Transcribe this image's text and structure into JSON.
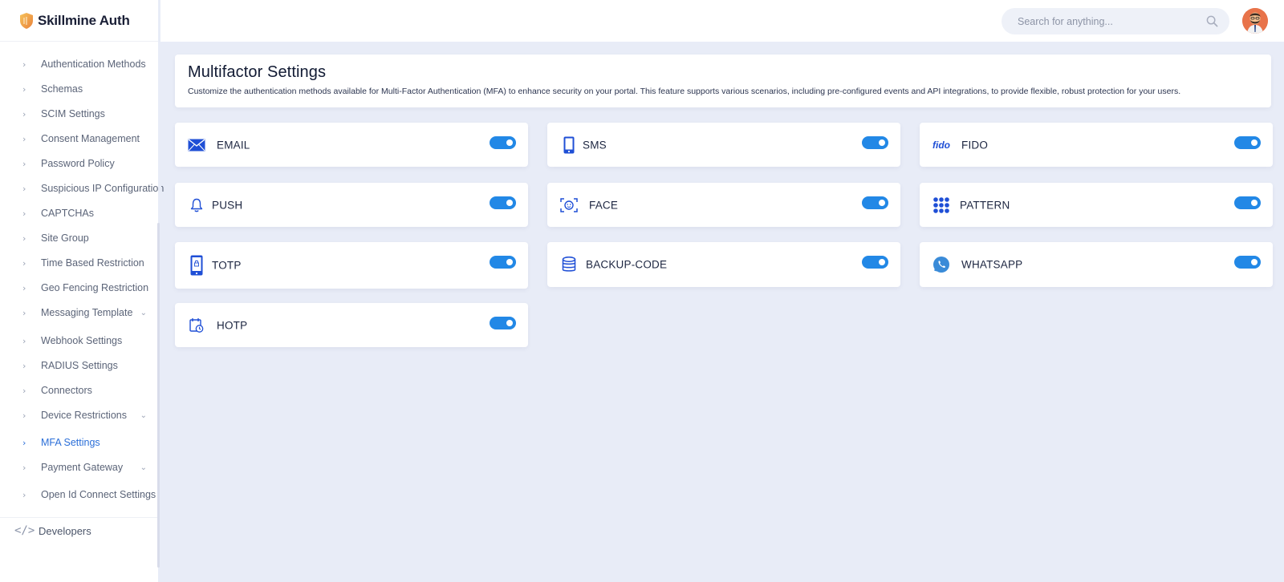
{
  "brand": {
    "name": "Skillmine Auth"
  },
  "header": {
    "search_placeholder": "Search for anything..."
  },
  "sidebar": {
    "items": [
      {
        "label": "Authentication Methods",
        "has_caret": false
      },
      {
        "label": "Schemas",
        "has_caret": false
      },
      {
        "label": "SCIM Settings",
        "has_caret": false
      },
      {
        "label": "Consent Management",
        "has_caret": false
      },
      {
        "label": "Password Policy",
        "has_caret": false
      },
      {
        "label": "Suspicious IP Configuration",
        "has_caret": false
      },
      {
        "label": "CAPTCHAs",
        "has_caret": false
      },
      {
        "label": "Site Group",
        "has_caret": false
      },
      {
        "label": "Time Based Restriction",
        "has_caret": false
      },
      {
        "label": "Geo Fencing Restriction",
        "has_caret": false
      },
      {
        "label": "Messaging Template",
        "has_caret": true
      },
      {
        "label": "Webhook Settings",
        "has_caret": false
      },
      {
        "label": "RADIUS Settings",
        "has_caret": false
      },
      {
        "label": "Connectors",
        "has_caret": false
      },
      {
        "label": "Device Restrictions",
        "has_caret": true
      },
      {
        "label": "MFA Settings",
        "has_caret": false,
        "active": true
      },
      {
        "label": "Payment Gateway",
        "has_caret": true
      },
      {
        "label": "Open Id Connect Settings",
        "has_caret": true
      }
    ],
    "developers": {
      "label": "Developers"
    }
  },
  "page": {
    "title": "Multifactor Settings",
    "description": "Customize the authentication methods available for Multi-Factor Authentication (MFA) to enhance security on your portal. This feature supports various scenarios, including pre-configured events and API integrations, to provide flexible, robust protection for your users."
  },
  "mfa_methods": [
    {
      "label": "EMAIL",
      "icon": "envelope-icon",
      "enabled": true
    },
    {
      "label": "SMS",
      "icon": "phone-icon",
      "enabled": true
    },
    {
      "label": "FIDO",
      "icon": "fido-logo",
      "enabled": true
    },
    {
      "label": "PUSH",
      "icon": "bell-icon",
      "enabled": true
    },
    {
      "label": "FACE",
      "icon": "face-scan-icon",
      "enabled": true
    },
    {
      "label": "PATTERN",
      "icon": "pattern-grid-icon",
      "enabled": true
    },
    {
      "label": "TOTP",
      "icon": "mobile-lock-icon",
      "enabled": true
    },
    {
      "label": "BACKUP-CODE",
      "icon": "database-icon",
      "enabled": true
    },
    {
      "label": "WHATSAPP",
      "icon": "whatsapp-icon",
      "enabled": true
    },
    {
      "label": "HOTP",
      "icon": "calendar-clock-icon",
      "enabled": true
    }
  ],
  "fido_logo_text": "fido",
  "colors": {
    "accent": "#2288e6",
    "icon_blue": "#1f4fd6",
    "active_nav": "#2a6ed8",
    "background": "#e8ecf7"
  }
}
